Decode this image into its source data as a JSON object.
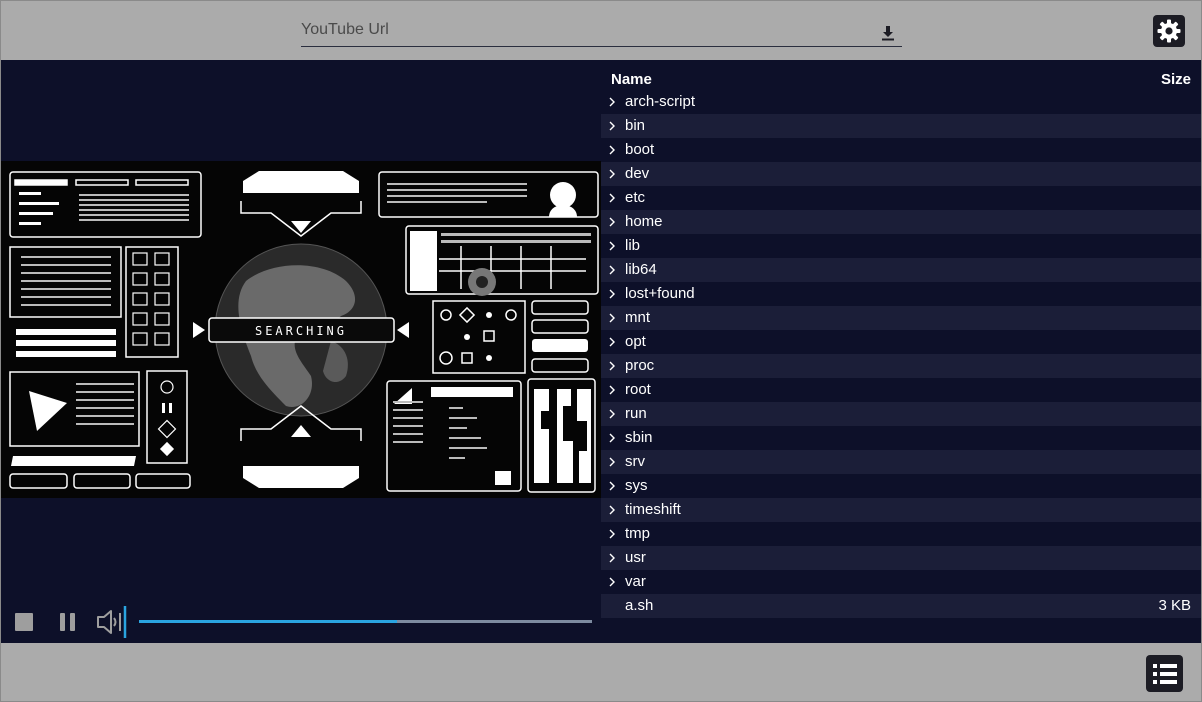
{
  "toolbar": {
    "url_placeholder": "YouTube Url",
    "url_value": "",
    "download_icon": "download-icon",
    "settings_icon": "gear-icon"
  },
  "player": {
    "video_overlay_text": "SEARCHING",
    "progress": 0.57,
    "controls": {
      "stop_icon": "stop-icon",
      "pause_icon": "pause-icon",
      "volume_icon": "volume-icon"
    }
  },
  "files": {
    "header": {
      "name": "Name",
      "size": "Size"
    },
    "rows": [
      {
        "name": "arch-script",
        "size": "",
        "folder": true
      },
      {
        "name": "bin",
        "size": "",
        "folder": true
      },
      {
        "name": "boot",
        "size": "",
        "folder": true
      },
      {
        "name": "dev",
        "size": "",
        "folder": true
      },
      {
        "name": "etc",
        "size": "",
        "folder": true
      },
      {
        "name": "home",
        "size": "",
        "folder": true
      },
      {
        "name": "lib",
        "size": "",
        "folder": true
      },
      {
        "name": "lib64",
        "size": "",
        "folder": true
      },
      {
        "name": "lost+found",
        "size": "",
        "folder": true
      },
      {
        "name": "mnt",
        "size": "",
        "folder": true
      },
      {
        "name": "opt",
        "size": "",
        "folder": true
      },
      {
        "name": "proc",
        "size": "",
        "folder": true
      },
      {
        "name": "root",
        "size": "",
        "folder": true
      },
      {
        "name": "run",
        "size": "",
        "folder": true
      },
      {
        "name": "sbin",
        "size": "",
        "folder": true
      },
      {
        "name": "srv",
        "size": "",
        "folder": true
      },
      {
        "name": "sys",
        "size": "",
        "folder": true
      },
      {
        "name": "timeshift",
        "size": "",
        "folder": true
      },
      {
        "name": "tmp",
        "size": "",
        "folder": true
      },
      {
        "name": "usr",
        "size": "",
        "folder": true
      },
      {
        "name": "var",
        "size": "",
        "folder": true
      },
      {
        "name": "a.sh",
        "size": "3 KB",
        "folder": false
      }
    ]
  },
  "bottombar": {
    "list_icon": "list-icon"
  },
  "colors": {
    "background": "#0d1029",
    "row_alt": "#1b1e38",
    "bar": "#ababab",
    "accent": "#2aa4e0"
  }
}
